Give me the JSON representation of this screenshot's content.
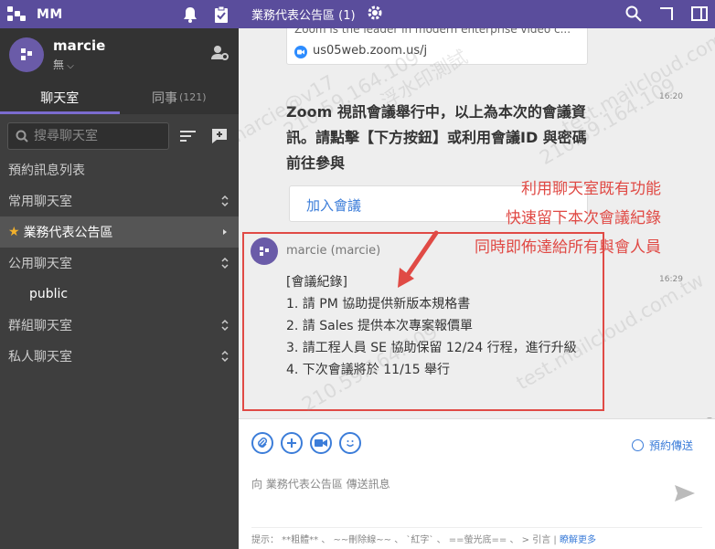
{
  "app": {
    "title": "MM"
  },
  "profile": {
    "name": "marcie",
    "status": "無"
  },
  "tabs": [
    {
      "label": "聊天室"
    },
    {
      "label": "同事",
      "count": "(121)"
    }
  ],
  "search": {
    "placeholder": "搜尋聊天室"
  },
  "nav": [
    {
      "label": "預約訊息列表"
    },
    {
      "label": "常用聊天室"
    },
    {
      "label": "業務代表公告區"
    },
    {
      "label": "公用聊天室"
    },
    {
      "label": "public"
    },
    {
      "label": "群組聊天室"
    },
    {
      "label": "私人聊天室"
    }
  ],
  "header": {
    "title": "業務代表公告區 (1)"
  },
  "link_card": {
    "snippet": "Zoom is the leader in modern enterprise video c...",
    "url": "us05web.zoom.us/j"
  },
  "message1": {
    "time": "16:20",
    "text": "Zoom 視訊會議舉行中，以上為本次的會議資訊。請點擊【下方按鈕】或利用會議ID 與密碼前往參與",
    "button": "加入會議"
  },
  "message2": {
    "sender": "marcie (marcie)",
    "time": "16:29",
    "lines": [
      "[會議紀錄]",
      "1. 請 PM 協助提供新版本規格書",
      "2. 請 Sales 提供本次專案報價單",
      "3. 請工程人員 SE 協助保留 12/24 行程，進行升級",
      "4. 下次會議將於 11/15 舉行"
    ]
  },
  "annotation": {
    "lines": [
      "利用聊天室既有功能",
      "快速留下本次會議紀錄",
      "同時即佈達給所有與會人員"
    ],
    "color": "#e04a45"
  },
  "composer": {
    "placeholder": "向 業務代表公告區 傳送訊息",
    "schedule": "預約傳送",
    "hint": "提示： **粗體** 、 ~~刪除線~~ 、 `紅字` 、 ==螢光底== 、 > 引言",
    "hint_link": "瞭解更多"
  },
  "watermark": {
    "a": "marcie@v17",
    "b": "210.59.164.109",
    "c": "浮水印測試",
    "d": "test.mailcloud.com.tw"
  },
  "colors": {
    "brand": "#5a4d9c",
    "sidebar": "#3e3e3e",
    "accent": "#3c7dd9"
  },
  "icons": [
    "bell-icon",
    "clipboard-check-icon",
    "user-settings-icon",
    "search-icon",
    "sort-icon",
    "compose-icon",
    "gear-icon",
    "maximize-icon",
    "split-view-icon",
    "star-icon",
    "chevron-right-icon",
    "chevron-updown-icon",
    "paperclip-icon",
    "plus-icon",
    "video-icon",
    "emoji-icon",
    "clock-icon",
    "send-icon",
    "zoom-icon"
  ]
}
